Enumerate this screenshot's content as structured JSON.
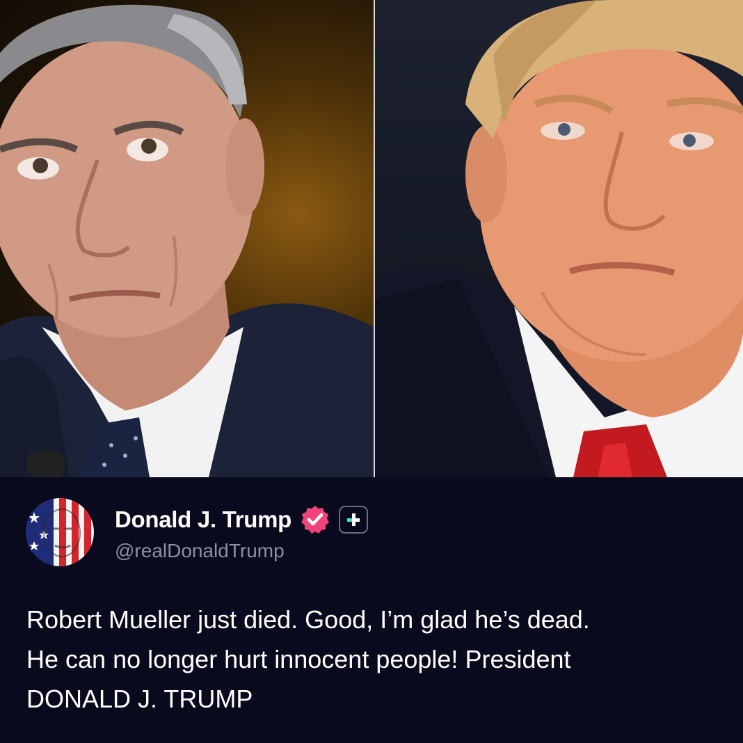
{
  "photos": {
    "left_subject": "portrait-left",
    "right_subject": "portrait-right"
  },
  "post": {
    "author": {
      "display_name": "Donald J. Trump",
      "handle": "@realDonaldTrump",
      "avatar_icon": "flag-portrait-avatar",
      "verified_icon": "verified-badge-icon",
      "verified_color": "#f0447a",
      "extra_badge_icon": "plus-badge-icon",
      "extra_badge_accent": "#2ee6c9"
    },
    "text": "Robert Mueller just died. Good, I’m glad he’s dead.\nHe can no longer hurt innocent people! President\nDONALD J. TRUMP"
  },
  "colors": {
    "background": "#0a0a1e",
    "handle_text": "#8b8fa3",
    "body_text": "#ffffff"
  }
}
